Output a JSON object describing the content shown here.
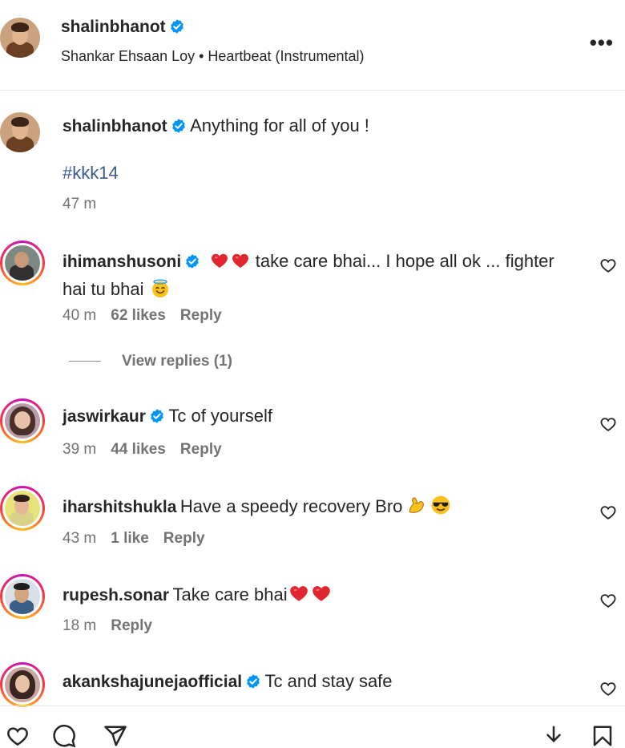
{
  "post": {
    "username": "shalinbhanot",
    "audio": "Shankar Ehsaan Loy • Heartbeat (Instrumental)",
    "more_label": "•••"
  },
  "caption": {
    "username": "shalinbhanot",
    "text": "Anything for all of you !",
    "hashtag": "#kkk14",
    "time": "47 m"
  },
  "comments": [
    {
      "username": "ihimanshusoni",
      "text_a": " take care bhai... I hope all ok ... fighter",
      "text_b": "hai tu bhai",
      "time": "40 m",
      "likes": "62 likes",
      "reply": "Reply"
    },
    {
      "username": "jaswirkaur",
      "text": "Tc of yourself",
      "time": "39 m",
      "likes": "44 likes",
      "reply": "Reply"
    },
    {
      "username": "iharshitshukla",
      "text": "Have a speedy recovery Bro",
      "time": "43 m",
      "likes": "1 like",
      "reply": "Reply"
    },
    {
      "username": "rupesh.sonar",
      "text": "Take care bhai",
      "time": "18 m",
      "reply": "Reply"
    },
    {
      "username": "akankshajunejaofficial",
      "text": "Tc and stay safe"
    }
  ],
  "view_replies": "View replies (1)",
  "colors": {
    "verified": "#0095f6",
    "heart": "#e0262f",
    "muted": "#737373",
    "link": "#3d5a93"
  }
}
